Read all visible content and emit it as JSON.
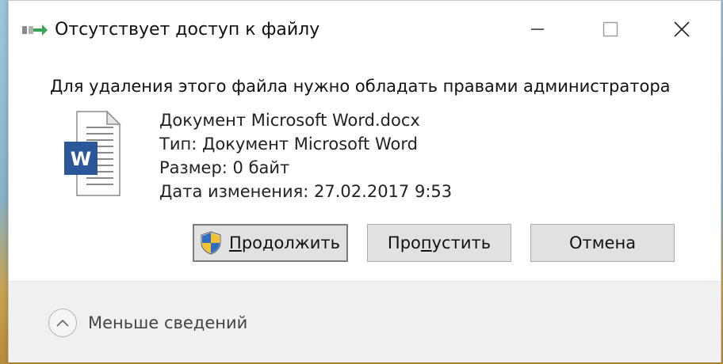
{
  "window": {
    "title": "Отсутствует доступ к файлу"
  },
  "message": "Для удаления этого файла нужно обладать правами администратора",
  "file": {
    "name": "Документ Microsoft Word.docx",
    "type": "Тип: Документ Microsoft Word",
    "size": "Размер: 0 байт",
    "modified": "Дата изменения: 27.02.2017 9:53",
    "icon_letter": "W"
  },
  "buttons": {
    "continue_label": "Продолжить",
    "continue_underline": "П",
    "continue_rest": "родолжить",
    "skip_pre": "Про",
    "skip_underline": "п",
    "skip_post": "устить",
    "cancel_label": "Отмена"
  },
  "footer": {
    "details_label": "Меньше сведений"
  },
  "colors": {
    "word_blue": "#2b579a",
    "button_bg": "#e1e1e1",
    "footer_bg": "#f0f0f0"
  }
}
